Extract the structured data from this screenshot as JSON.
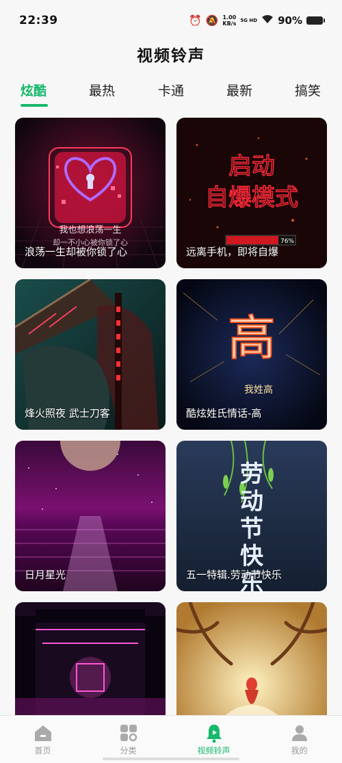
{
  "status_bar": {
    "time": "22:39",
    "speed_value": "1.00",
    "speed_unit": "KB/s",
    "network": "5G HD",
    "battery": "90%"
  },
  "page_title": "视频铃声",
  "tabs": [
    {
      "label": "炫酷",
      "active": true
    },
    {
      "label": "最热",
      "active": false
    },
    {
      "label": "卡通",
      "active": false
    },
    {
      "label": "最新",
      "active": false
    },
    {
      "label": "搞笑",
      "active": false
    }
  ],
  "cards": [
    {
      "caption": "浪荡一生却被你锁了心",
      "overlay_text": "我也想浪荡一生",
      "overlay_text_2": "却一不小心被你锁了心"
    },
    {
      "caption": "远离手机，即将自爆",
      "overlay_line_1": "启动",
      "overlay_line_2": "自爆模式",
      "progress_text": "76%",
      "progress": 0.76
    },
    {
      "caption": "烽火照夜 武士刀客"
    },
    {
      "caption": "酷炫姓氏情话-高",
      "overlay_char": "高",
      "overlay_small": "我姓高"
    },
    {
      "caption": "日月星光"
    },
    {
      "caption": "五一特辑.劳动节快乐",
      "overlay_vertical": "劳动节快乐"
    },
    {
      "caption": ""
    },
    {
      "caption": ""
    }
  ],
  "bottom_nav": [
    {
      "label": "首页",
      "icon": "home-icon",
      "active": false
    },
    {
      "label": "分类",
      "icon": "category-icon",
      "active": false
    },
    {
      "label": "视频铃声",
      "icon": "bell-icon",
      "active": true
    },
    {
      "label": "我的",
      "icon": "profile-icon",
      "active": false
    }
  ],
  "colors": {
    "accent": "#16b86a",
    "text": "#111111",
    "muted": "#999999"
  }
}
